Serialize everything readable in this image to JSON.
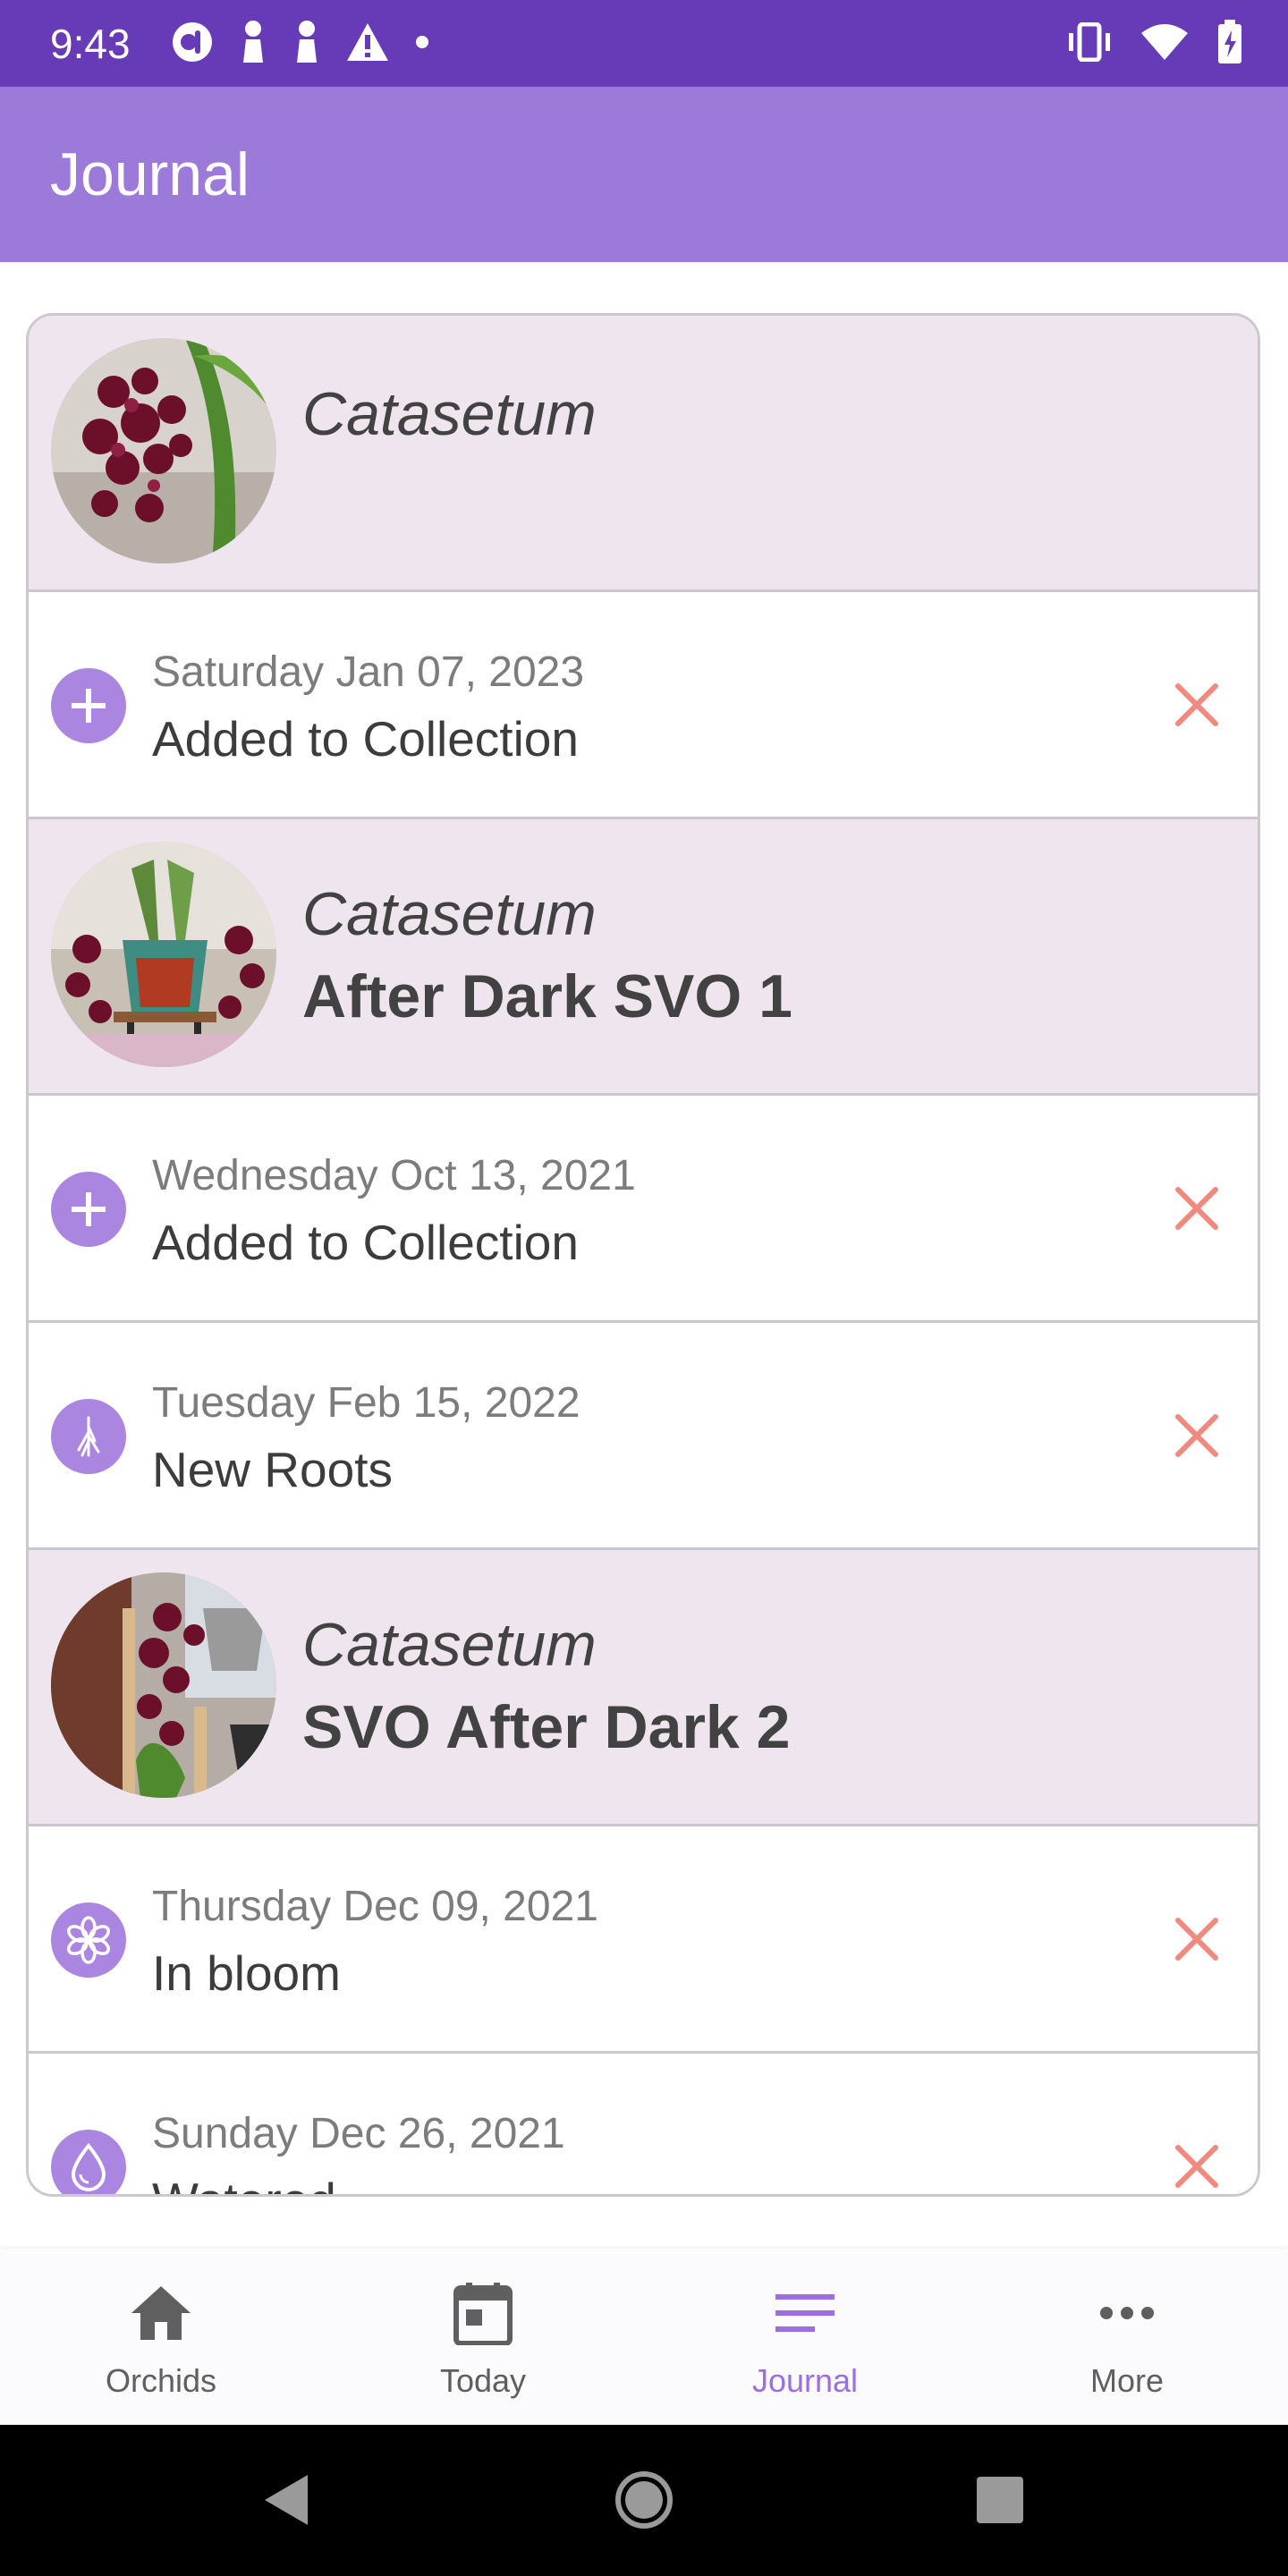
{
  "status_bar": {
    "time": "9:43",
    "left_icons": [
      "podcast-icon",
      "person-icon",
      "person-icon",
      "warning-icon",
      "dot-icon"
    ],
    "right_icons": [
      "vibrate-icon",
      "wifi-icon",
      "battery-icon"
    ]
  },
  "app_bar": {
    "title": "Journal"
  },
  "entries": [
    {
      "genus": "Catasetum",
      "cultivar": "",
      "events": [
        {
          "date": "Saturday Jan 07, 2023",
          "label": "Added to Collection",
          "icon": "plus-icon"
        }
      ]
    },
    {
      "genus": "Catasetum",
      "cultivar": "After Dark SVO 1",
      "events": [
        {
          "date": "Wednesday Oct 13, 2021",
          "label": "Added to Collection",
          "icon": "plus-icon"
        },
        {
          "date": "Tuesday Feb 15, 2022",
          "label": "New Roots",
          "icon": "roots-icon"
        }
      ]
    },
    {
      "genus": "Catasetum",
      "cultivar": "SVO After Dark 2",
      "events": [
        {
          "date": "Thursday Dec 09, 2021",
          "label": "In bloom",
          "icon": "flower-icon"
        },
        {
          "date": "Sunday Dec 26, 2021",
          "label": "Watered",
          "icon": "water-drop-icon"
        }
      ]
    }
  ],
  "bottom_nav": {
    "items": [
      {
        "label": "Orchids",
        "icon": "home-icon"
      },
      {
        "label": "Today",
        "icon": "calendar-icon"
      },
      {
        "label": "Journal",
        "icon": "list-icon",
        "active": true
      },
      {
        "label": "More",
        "icon": "more-horiz-icon"
      }
    ]
  },
  "colors": {
    "status_bar": "#673ab7",
    "app_bar": "#9c7ada",
    "header_row": "#efe5ef",
    "accent": "#ab86e0",
    "delete": "#f08a80",
    "active_nav": "#9c6ee0"
  }
}
